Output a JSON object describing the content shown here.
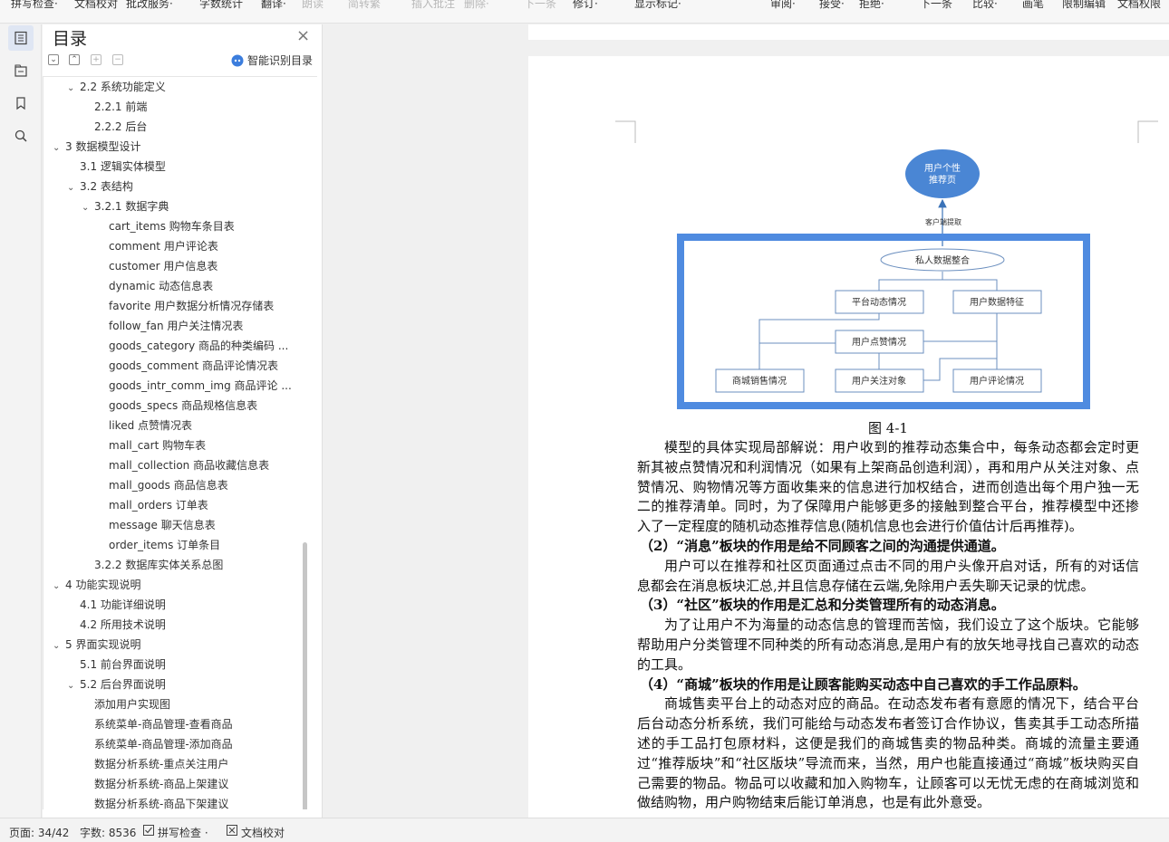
{
  "toolbar": {
    "spell_check": "拼写检查·",
    "doc_proof": "文档校对",
    "revise_service": "批改服务·",
    "word_count": "字数统计",
    "translate": "翻译·",
    "read_aloud": "朗读",
    "simp_trad": "简转繁",
    "insert_comment": "插入批注",
    "delete": "删除·",
    "next_item_1": "下一条",
    "track": "修订·",
    "show_marks": "显示标记·",
    "review": "审阅·",
    "accept": "接受·",
    "reject": "拒绝·",
    "next_item_2": "下一条",
    "compare": "比较·",
    "pen": "画笔",
    "restrict_edit": "限制编辑",
    "doc_rights": "文档权限"
  },
  "toc": {
    "title": "目录",
    "smart_label": "智能识别目录",
    "items": [
      {
        "text": "2.2  系统功能定义",
        "level": 1,
        "arrow": true
      },
      {
        "text": "2.2.1  前端",
        "level": 2,
        "arrow": false
      },
      {
        "text": "2.2.2  后台",
        "level": 2,
        "arrow": false
      },
      {
        "text": "3  数据模型设计",
        "level": 0,
        "arrow": true
      },
      {
        "text": "3.1  逻辑实体模型",
        "level": 1,
        "arrow": false
      },
      {
        "text": "3.2  表结构",
        "level": 1,
        "arrow": true
      },
      {
        "text": "3.2.1 数据字典",
        "level": 2,
        "arrow": true
      },
      {
        "text": "cart_items 购物车条目表",
        "level": 3,
        "arrow": false
      },
      {
        "text": "comment 用户评论表",
        "level": 3,
        "arrow": false
      },
      {
        "text": "customer 用户信息表",
        "level": 3,
        "arrow": false
      },
      {
        "text": "dynamic 动态信息表",
        "level": 3,
        "arrow": false
      },
      {
        "text": "favorite 用户数据分析情况存储表",
        "level": 3,
        "arrow": false
      },
      {
        "text": "follow_fan 用户关注情况表",
        "level": 3,
        "arrow": false
      },
      {
        "text": "goods_category 商品的种类编码 ...",
        "level": 3,
        "arrow": false
      },
      {
        "text": "goods_comment 商品评论情况表",
        "level": 3,
        "arrow": false
      },
      {
        "text": "goods_intr_comm_img 商品评论 ...",
        "level": 3,
        "arrow": false
      },
      {
        "text": "goods_specs 商品规格信息表",
        "level": 3,
        "arrow": false
      },
      {
        "text": "liked 点赞情况表",
        "level": 3,
        "arrow": false
      },
      {
        "text": "mall_cart 购物车表",
        "level": 3,
        "arrow": false
      },
      {
        "text": "mall_collection 商品收藏信息表",
        "level": 3,
        "arrow": false
      },
      {
        "text": "mall_goods 商品信息表",
        "level": 3,
        "arrow": false
      },
      {
        "text": "mall_orders 订单表",
        "level": 3,
        "arrow": false
      },
      {
        "text": "message 聊天信息表",
        "level": 3,
        "arrow": false
      },
      {
        "text": "order_items 订单条目",
        "level": 3,
        "arrow": false
      },
      {
        "text": "3.2.2 数据库实体关系总图",
        "level": 2,
        "arrow": false
      },
      {
        "text": "4  功能实现说明",
        "level": 0,
        "arrow": true
      },
      {
        "text": "4.1  功能详细说明",
        "level": 1,
        "arrow": false
      },
      {
        "text": "4.2  所用技术说明",
        "level": 1,
        "arrow": false
      },
      {
        "text": "5  界面实现说明",
        "level": 0,
        "arrow": true
      },
      {
        "text": "5.1 前台界面说明",
        "level": 1,
        "arrow": false
      },
      {
        "text": "5.2 后台界面说明",
        "level": 1,
        "arrow": true
      },
      {
        "text": "添加用户实现图",
        "level": 2,
        "arrow": false
      },
      {
        "text": "系统菜单-商品管理-查看商品",
        "level": 2,
        "arrow": false
      },
      {
        "text": "系统菜单-商品管理-添加商品",
        "level": 2,
        "arrow": false
      },
      {
        "text": "数据分析系统-重点关注用户",
        "level": 2,
        "arrow": false
      },
      {
        "text": "数据分析系统-商品上架建议",
        "level": 2,
        "arrow": false
      },
      {
        "text": "数据分析系统-商品下架建议",
        "level": 2,
        "arrow": false
      }
    ]
  },
  "diagram": {
    "top_node": "用户个性推荐页",
    "top_line1": "用户个性",
    "top_line2": "推荐页",
    "edge_label": "客户端提取",
    "integrate": "私人数据整合",
    "platform": "平台动态情况",
    "features": "用户数据特征",
    "likes": "用户点赞情况",
    "sales": "商城销售情况",
    "follows": "用户关注对象",
    "comments": "用户评论情况"
  },
  "document": {
    "caption": "图 4-1",
    "p1": "模型的具体实现局部解说：用户收到的推荐动态集合中，每条动态都会定时更新其被点赞情况和利润情况（如果有上架商品创造利润），再和用户从关注对象、点赞情况、购物情况等方面收集来的信息进行加权结合，进而创造出每个用户独一无二的推荐清单。同时，为了保障用户能够更多的接触到整合平台，推荐模型中还掺入了一定程度的随机动态推荐信息(随机信息也会进行价值估计后再推荐)。",
    "h2": "（2）“消息”板块的作用是给不同顾客之间的沟通提供通道。",
    "p2": "用户可以在推荐和社区页面通过点击不同的用户头像开启对话，所有的对话信息都会在消息板块汇总,并且信息存储在云端,免除用户丢失聊天记录的忧虑。",
    "h3": "（3）“社区”板块的作用是汇总和分类管理所有的动态消息。",
    "p3": "为了让用户不为海量的动态信息的管理而苦恼，我们设立了这个版块。它能够帮助用户分类管理不同种类的所有动态消息,是用户有的放矢地寻找自己喜欢的动态的工具。",
    "h4": "（4）“商城”板块的作用是让顾客能购买动态中自己喜欢的手工作品原料。",
    "p4": "商城售卖平台上的动态对应的商品。在动态发布者有意愿的情况下，结合平台后台动态分析系统，我们可能给与动态发布者签订合作协议，售卖其手工动态所描述的手工品打包原材料，这便是我们的商城售卖的物品种类。商城的流量主要通过“推荐版块”和“社区版块”导流而来，当然，用户也能直接通过“商城”板块购买自己需要的物品。物品可以收藏和加入购物车，让顾客可以无忧无虑的在商城浏览和做结购物，用户购物结束后能订单消息，也是有此外意受。"
  },
  "status": {
    "page": "页面: 34/42",
    "words": "字数: 8536",
    "spell": "拼写检查 ·",
    "proof": "文档校对"
  }
}
